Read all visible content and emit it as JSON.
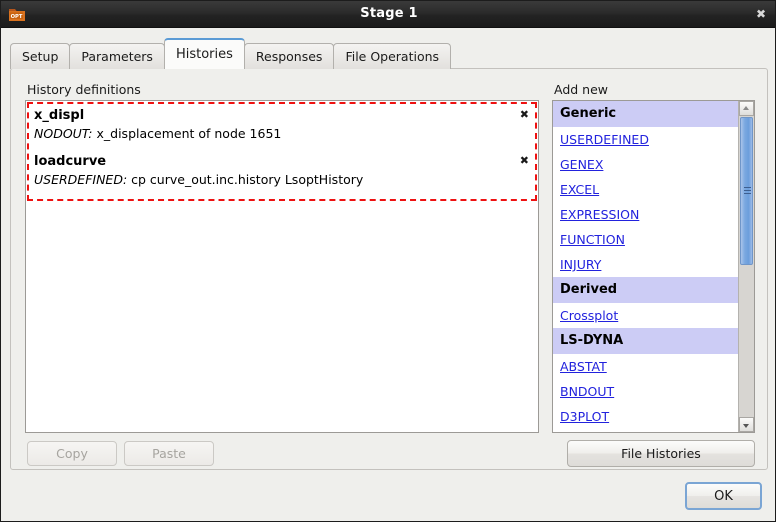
{
  "window": {
    "title": "Stage 1",
    "app_icon": "opt-folder-icon",
    "close_label": "✖"
  },
  "tabs": [
    {
      "label": "Setup",
      "active": false
    },
    {
      "label": "Parameters",
      "active": false
    },
    {
      "label": "Histories",
      "active": true
    },
    {
      "label": "Responses",
      "active": false
    },
    {
      "label": "File Operations",
      "active": false
    }
  ],
  "panels": {
    "history_definitions_label": "History definitions",
    "add_new_label": "Add new"
  },
  "histories": [
    {
      "name": "x_displ",
      "kind": "NODOUT:",
      "description": "x_displacement of node 1651",
      "close_label": "✖"
    },
    {
      "name": "loadcurve",
      "kind": "USERDEFINED:",
      "description": "cp curve_out.inc.history LsoptHistory",
      "close_label": "✖"
    }
  ],
  "add_new_list": [
    {
      "type": "group",
      "label": "Generic"
    },
    {
      "type": "item",
      "label": "USERDEFINED"
    },
    {
      "type": "item",
      "label": "GENEX"
    },
    {
      "type": "item",
      "label": "EXCEL"
    },
    {
      "type": "item",
      "label": "EXPRESSION"
    },
    {
      "type": "item",
      "label": "FUNCTION"
    },
    {
      "type": "item",
      "label": "INJURY"
    },
    {
      "type": "group",
      "label": "Derived"
    },
    {
      "type": "item",
      "label": "Crossplot"
    },
    {
      "type": "group",
      "label": "LS-DYNA"
    },
    {
      "type": "item",
      "label": "ABSTAT"
    },
    {
      "type": "item",
      "label": "BNDOUT"
    },
    {
      "type": "item",
      "label": "D3PLOT"
    }
  ],
  "buttons": {
    "copy": "Copy",
    "paste": "Paste",
    "file_histories": "File Histories",
    "ok": "OK"
  },
  "colors": {
    "group_header_bg": "#ccccf5",
    "link": "#2222dd",
    "selection_outline": "#ee1111",
    "active_tab_accent": "#5b9bd5",
    "scrollbar_thumb": "#7aa8e0"
  }
}
